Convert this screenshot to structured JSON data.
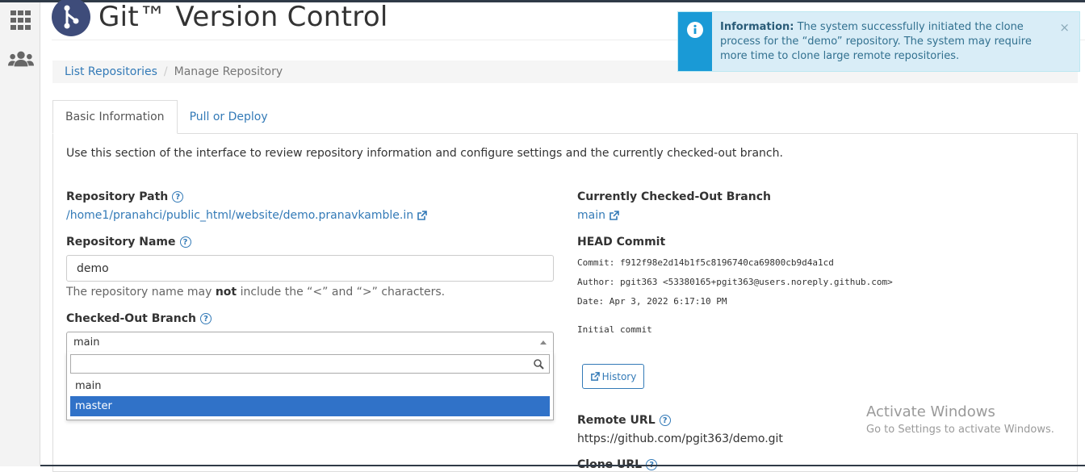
{
  "app": {
    "title": "Git™ Version Control"
  },
  "breadcrumb": {
    "list": "List Repositories",
    "sep": "/",
    "current": "Manage Repository"
  },
  "alert": {
    "label": "Information:",
    "text": "The system successfully initiated the clone process for the “demo” repository. The system may require more time to clone large remote repositories.",
    "close": "×"
  },
  "tabs": [
    {
      "label": "Basic Information"
    },
    {
      "label": "Pull or Deploy"
    }
  ],
  "intro": "Use this section of the interface to review repository information and configure settings and the currently checked-out branch.",
  "repo_path": {
    "label": "Repository Path",
    "value": "/home1/pranahci/public_html/website/demo.pranavkamble.in"
  },
  "repo_name": {
    "label": "Repository Name",
    "value": "demo",
    "hint_pre": "The repository name may ",
    "hint_bold": "not",
    "hint_post": " include the “<” and “>” characters."
  },
  "branch": {
    "label": "Checked-Out Branch",
    "selected": "main",
    "options": [
      "main",
      "master"
    ],
    "highlighted": "master"
  },
  "current_branch": {
    "label": "Currently Checked-Out Branch",
    "value": "main"
  },
  "head_commit": {
    "label": "HEAD Commit",
    "commit_label": "Commit:",
    "commit": "f912f98e2d14b1f5c8196740ca69800cb9d4a1cd",
    "author_label": "Author:",
    "author": "pgit363 <53380165+pgit363@users.noreply.github.com>",
    "date_label": "Date:",
    "date": "Apr 3, 2022 6:17:10 PM",
    "message": "Initial commit"
  },
  "history_button": "History",
  "remote_url": {
    "label": "Remote URL",
    "value": "https://github.com/pgit363/demo.git"
  },
  "clone_url": {
    "label": "Clone URL"
  },
  "watermark": {
    "title": "Activate Windows",
    "subtitle": "Go to Settings to activate Windows."
  },
  "colors": {
    "link": "#337ab7",
    "alert_bg": "#d9edf7",
    "alert_icon": "#1a9ad6",
    "highlight": "#3072c8"
  }
}
